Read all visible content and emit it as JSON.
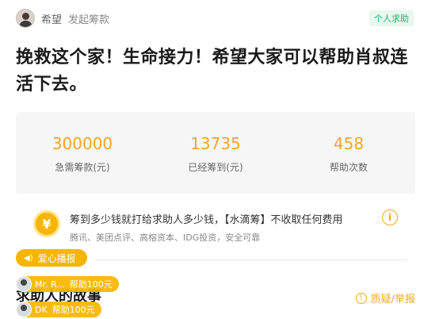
{
  "header": {
    "author": "希望",
    "author_action": "发起筹款",
    "tag": "个人求助"
  },
  "title": "挽救这个家！生命接力！希望大家可以帮助肖叔连活下去。",
  "stats": [
    {
      "value": "300000",
      "label": "急需筹款(元)"
    },
    {
      "value": "13735",
      "label": "已经筹到(元)"
    },
    {
      "value": "458",
      "label": "帮助次数"
    }
  ],
  "promise": {
    "icon": "yen-icon",
    "text": "筹到多少钱就打给求助人多少钱，【水滴筹】不收取任何费用",
    "partners": "腾讯、美团点评、高榕资本、IDG投资，安全可靠"
  },
  "broadcast": {
    "label": "爱心播报"
  },
  "donors": [
    {
      "name": "Mr. R...",
      "amount": "帮助100元"
    },
    {
      "name": "DK",
      "amount": "帮助100元"
    }
  ],
  "story": {
    "title": "求助人的故事"
  },
  "report": {
    "label": "质疑/举报"
  },
  "colors": {
    "accent": "#f5a623",
    "tag_green": "#27b06e",
    "badge": "#f7b500"
  }
}
